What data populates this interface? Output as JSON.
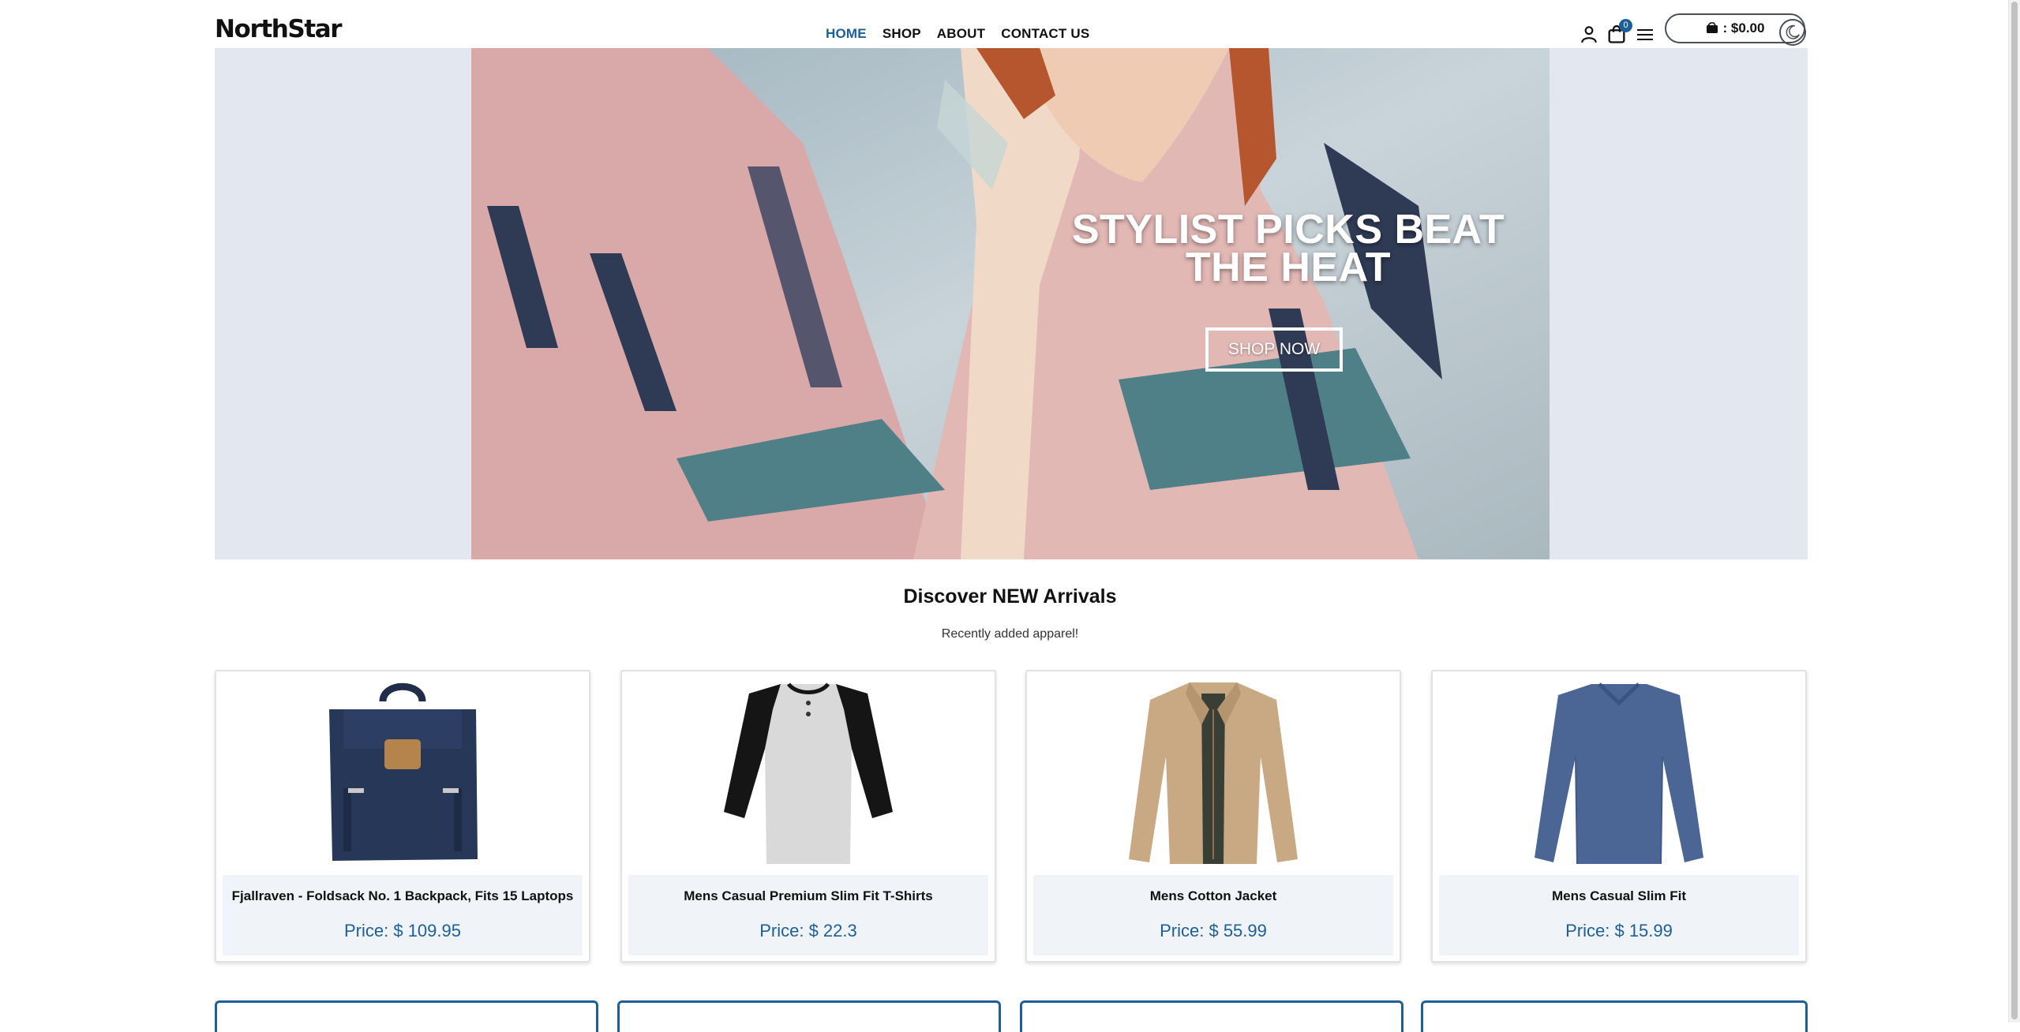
{
  "header": {
    "logo": "NorthStar",
    "nav": [
      {
        "label": "HOME",
        "active": true
      },
      {
        "label": "SHOP",
        "active": false
      },
      {
        "label": "ABOUT",
        "active": false
      },
      {
        "label": "CONTACT US",
        "active": false
      }
    ],
    "cart_count": "0",
    "cart_total_label": ": $0.00",
    "icons": [
      "user-icon",
      "shopping-bag-icon",
      "menu-icon",
      "wallet-icon",
      "moon-icon"
    ]
  },
  "hero": {
    "title": "STYLIST PICKS BEAT THE HEAT",
    "button": "SHOP NOW"
  },
  "arrivals": {
    "title": "Discover NEW Arrivals",
    "subtitle": "Recently added apparel!",
    "products": [
      {
        "name": "Fjallraven - Foldsack No. 1 Backpack, Fits 15 Laptops",
        "price": "Price: $ 109.95",
        "image": "backpack"
      },
      {
        "name": "Mens Casual Premium Slim Fit T-Shirts",
        "price": "Price: $ 22.3",
        "image": "raglan-shirt"
      },
      {
        "name": "Mens Cotton Jacket",
        "price": "Price: $ 55.99",
        "image": "jacket"
      },
      {
        "name": "Mens Casual Slim Fit",
        "price": "Price: $ 15.99",
        "image": "long-sleeve-shirt"
      }
    ]
  },
  "colors": {
    "accent": "#1d5f97",
    "hero_bg": "#e3e8f0",
    "card_info_bg": "#f0f3f7"
  }
}
